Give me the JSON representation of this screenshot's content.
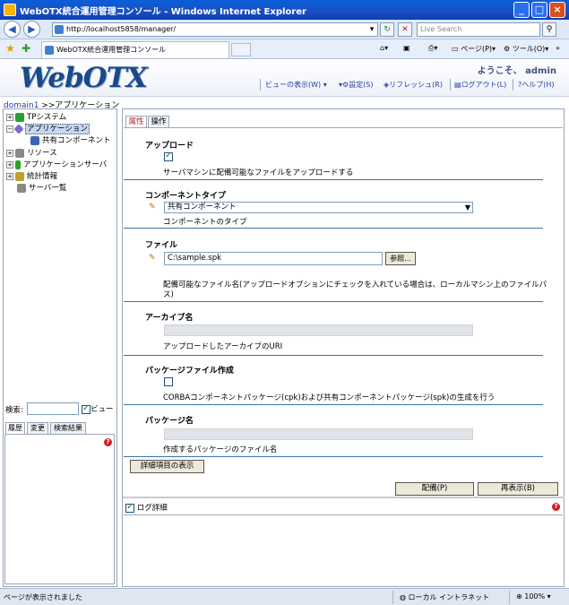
{
  "window": {
    "title": "WebOTX統合運用管理コンソール - Windows Internet Explorer",
    "minimize": "_",
    "maximize": "□",
    "close": "×"
  },
  "browser": {
    "url": "http://localhost5858/manager/",
    "search_placeholder": "Live Search",
    "tab_title": "WebOTX統合運用管理コンソール",
    "commands": {
      "page": "ページ(P)",
      "tools": "ツール(O)"
    }
  },
  "app": {
    "logo": "WebOTX",
    "welcome": "ようこそ、 admin",
    "header_links": {
      "view": "ビューの表示(W)",
      "settings": "設定(S)",
      "refresh": "リフレッシュ(R)",
      "logout": "ログアウト(L)",
      "help": "ヘルプ(H)"
    }
  },
  "breadcrumb": {
    "link": "domain1",
    "rest": " >>アプリケーション"
  },
  "tree": [
    {
      "label": "TPシステム",
      "expander": "+"
    },
    {
      "label": "アプリケーション",
      "expander": "−"
    },
    {
      "label": "共有コンポーネント",
      "expander": ""
    },
    {
      "label": "リソース",
      "expander": "+"
    },
    {
      "label": "アプリケーションサーバ",
      "expander": "+"
    },
    {
      "label": "統計情報",
      "expander": "+"
    },
    {
      "label": "サーバ一覧",
      "expander": ""
    }
  ],
  "left_search": {
    "label": "検索:",
    "view_label": "ビュー"
  },
  "left_tabs": [
    "履歴",
    "変更",
    "検索結果"
  ],
  "right_tabs": {
    "attributes": "属性",
    "operations": "操作"
  },
  "form": {
    "upload": {
      "title": "アップロード",
      "desc": "サーバマシンに配備可能なファイルをアップロードする",
      "checked": true
    },
    "component_type": {
      "title": "コンポーネントタイプ",
      "value": "共有コンポーネント",
      "desc": "コンポーネントのタイプ"
    },
    "file": {
      "title": "ファイル",
      "value": "C:\\sample.spk",
      "browse": "参照...",
      "desc_line1": "配備可能なファイル名(アップロードオプションにチェックを入れている場合は、ローカルマシン上のファイルパ",
      "desc_line2": "ス)"
    },
    "archive": {
      "title": "アーカイブ名",
      "desc": "アップロードしたアーカイブのURI"
    },
    "package_create": {
      "title": "パッケージファイル作成",
      "desc": "CORBAコンポーネントパッケージ(cpk)および共有コンポーネントパッケージ(spk)の生成を行う",
      "checked": false
    },
    "package_name": {
      "title": "パッケージ名",
      "desc": "作成するパッケージのファイル名"
    },
    "details_button": "詳細項目の表示",
    "deploy_button": "配備(P)",
    "redisplay_button": "再表示(B)"
  },
  "log": {
    "label": "ログ詳細",
    "checked": true
  },
  "status": {
    "message": "ページが表示されました",
    "zone": "ローカル イントラネット",
    "zoom": "100%"
  },
  "colors": {
    "titlebar": "#0a5fd8",
    "section_line": "#3b74a8",
    "link": "#1f3fa5"
  }
}
